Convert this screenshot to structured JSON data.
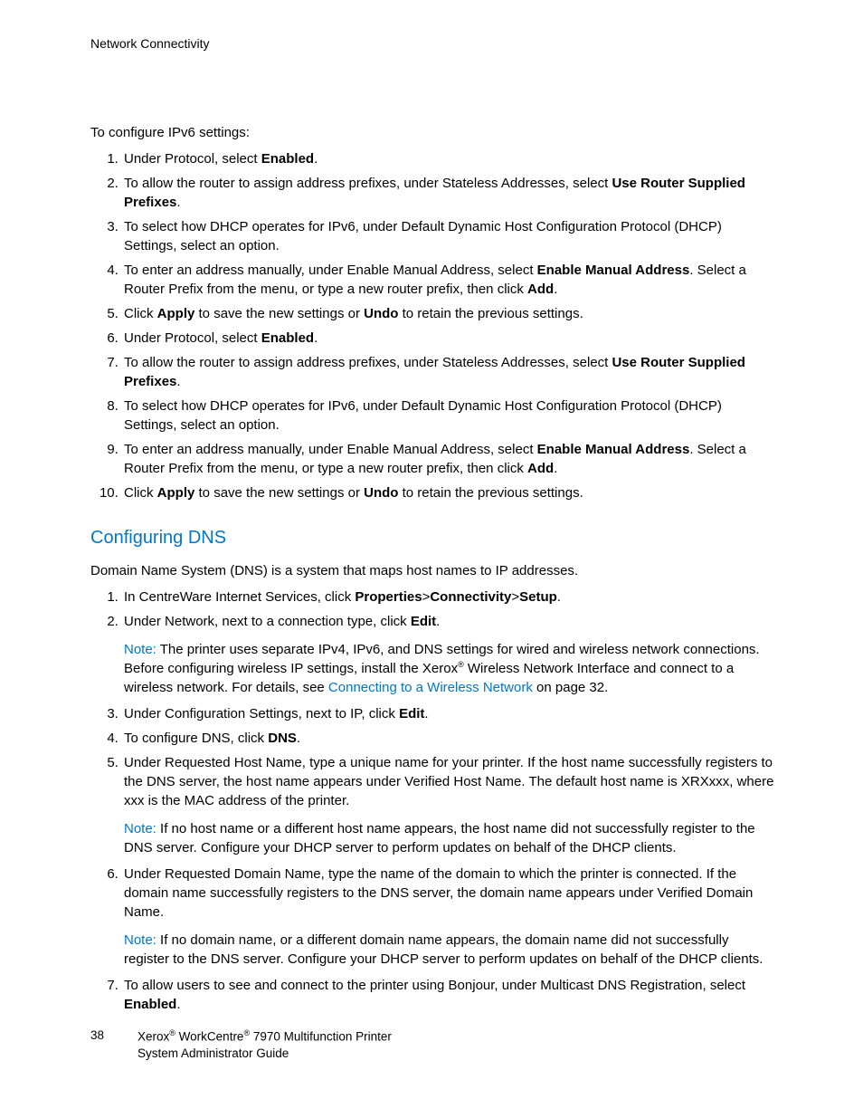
{
  "header": "Network Connectivity",
  "intro1": "To configure IPv6 settings:",
  "list1": {
    "i1_pre": "Under Protocol, select ",
    "i1_b": "Enabled",
    "i1_post": ".",
    "i2_pre": "To allow the router to assign address prefixes, under Stateless Addresses, select ",
    "i2_b": "Use Router Supplied Prefixes",
    "i2_post": ".",
    "i3": "To select how DHCP operates for IPv6, under Default Dynamic Host Configuration Protocol (DHCP) Settings, select an option.",
    "i4_pre": "To enter an address manually, under Enable Manual Address, select ",
    "i4_b": "Enable Manual Address",
    "i4_mid": ". Select a Router Prefix from the menu, or type a new router prefix, then click ",
    "i4_b2": "Add",
    "i4_post": ".",
    "i5_pre": "Click ",
    "i5_b1": "Apply",
    "i5_mid": " to save the new settings or ",
    "i5_b2": "Undo",
    "i5_post": " to retain the previous settings.",
    "i6_pre": "Under Protocol, select ",
    "i6_b": "Enabled",
    "i6_post": ".",
    "i7_pre": "To allow the router to assign address prefixes, under Stateless Addresses, select ",
    "i7_b": "Use Router Supplied Prefixes",
    "i7_post": ".",
    "i8": "To select how DHCP operates for IPv6, under Default Dynamic Host Configuration Protocol (DHCP) Settings, select an option.",
    "i9_pre": "To enter an address manually, under Enable Manual Address, select ",
    "i9_b": "Enable Manual Address",
    "i9_mid": ". Select a Router Prefix from the menu, or type a new router prefix, then click ",
    "i9_b2": "Add",
    "i9_post": ".",
    "i10_pre": "Click ",
    "i10_b1": "Apply",
    "i10_mid": " to save the new settings or ",
    "i10_b2": "Undo",
    "i10_post": " to retain the previous settings."
  },
  "h2": "Configuring DNS",
  "dns_intro": "Domain Name System (DNS) is a system that maps host names to IP addresses.",
  "list2": {
    "i1_pre": "In CentreWare Internet Services, click ",
    "i1_b": "Properties",
    "i1_gt1": ">",
    "i1_b2": "Connectivity",
    "i1_gt2": ">",
    "i1_b3": "Setup",
    "i1_post": ".",
    "i2_pre": "Under Network, next to a connection type, click ",
    "i2_b": "Edit",
    "i2_post": ".",
    "note1_label": "Note:",
    "note1_pre": " The printer uses separate IPv4, IPv6, and DNS settings for wired and wireless network connections. Before configuring wireless IP settings, install the Xerox",
    "note1_mid": " Wireless Network Interface and connect to a wireless network. For details, see ",
    "note1_link": "Connecting to a Wireless Network",
    "note1_post": " on page 32.",
    "i3_pre": "Under Configuration Settings, next to IP, click ",
    "i3_b": "Edit",
    "i3_post": ".",
    "i4_pre": "To configure DNS, click ",
    "i4_b": "DNS",
    "i4_post": ".",
    "i5": "Under Requested Host Name, type a unique name for your printer. If the host name successfully registers to the DNS server, the host name appears under Verified Host Name. The default host name is XRXxxx, where xxx is the MAC address of the printer.",
    "note2_label": "Note:",
    "note2": " If no host name or a different host name appears, the host name did not successfully register to the DNS server. Configure your DHCP server to perform updates on behalf of the DHCP clients.",
    "i6": "Under Requested Domain Name, type the name of the domain to which the printer is connected. If the domain name successfully registers to the DNS server, the domain name appears under Verified Domain Name.",
    "note3_label": "Note:",
    "note3": " If no domain name, or a different domain name appears, the domain name did not successfully register to the DNS server. Configure your DHCP server to perform updates on behalf of the DHCP clients.",
    "i7_pre": "To allow users to see and connect to the printer using Bonjour, under Multicast DNS Registration, select ",
    "i7_b": "Enabled",
    "i7_post": "."
  },
  "footer": {
    "page": "38",
    "l1_a": "Xerox",
    "l1_b": " WorkCentre",
    "l1_c": " 7970 Multifunction Printer",
    "l2": "System Administrator Guide",
    "reg": "®"
  }
}
